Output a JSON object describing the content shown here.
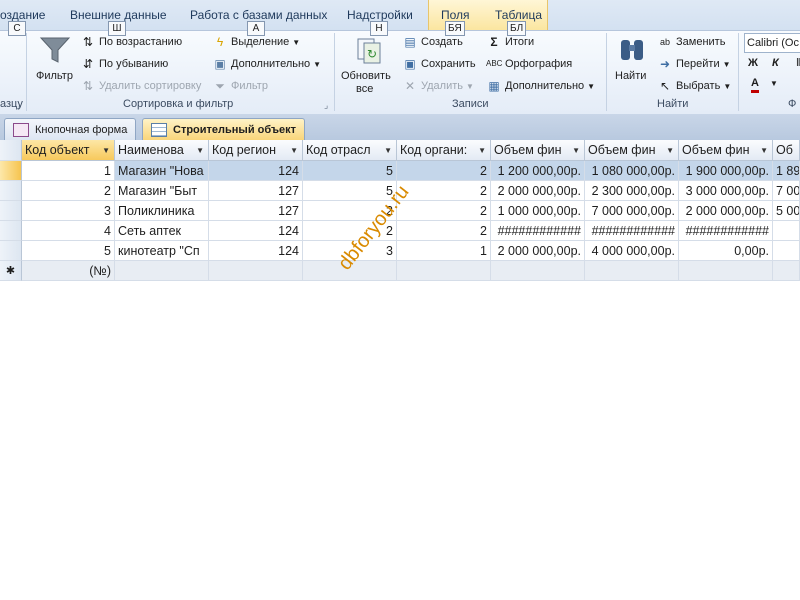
{
  "ribbon_tabs": [
    "оздание",
    "Внешние данные",
    "Работа с базами данных",
    "Надстройки",
    "Поля",
    "Таблица"
  ],
  "keytips": [
    "С",
    "Ш",
    "А",
    "Н",
    "БЯ",
    "БЛ"
  ],
  "sort_group": {
    "filter_label": "Фильтр",
    "ascending": "По возрастанию",
    "descending": "По убыванию",
    "remove_sort": "Удалить сортировку",
    "selection": "Выделение",
    "advanced": "Дополнительно",
    "toggle_filter": "Фильтр",
    "label": "Сортировка и фильтр"
  },
  "left_group": {
    "label": "азцу"
  },
  "records_group": {
    "refresh": "Обновить",
    "refresh_sub": "все",
    "new": "Создать",
    "save": "Сохранить",
    "delete": "Удалить",
    "totals": "Итоги",
    "spelling": "Орфография",
    "more": "Дополнительно",
    "label": "Записи"
  },
  "find_group": {
    "find": "Найти",
    "replace": "Заменить",
    "goto": "Перейти",
    "select": "Выбрать",
    "label": "Найти"
  },
  "font_group": {
    "font_name": "Calibri (Ос",
    "bold": "Ж",
    "italic": "К",
    "font_color": "А",
    "label": "Ф"
  },
  "doc_tabs": [
    {
      "label": "Кнопочная форма",
      "active": false
    },
    {
      "label": "Строительный объект",
      "active": true
    }
  ],
  "columns": [
    "Код объект",
    "Наименова",
    "Код регион",
    "Код отрасл",
    "Код органи:",
    "Объем фин",
    "Объем фин",
    "Объем фин",
    "Об"
  ],
  "rows": [
    [
      "1",
      "Магазин \"Нова",
      "124",
      "5",
      "2",
      "1 200 000,00р.",
      "1 080 000,00р.",
      "1 900 000,00р.",
      "1 89"
    ],
    [
      "2",
      "Магазин \"Быт",
      "127",
      "5",
      "2",
      "2 000 000,00р.",
      "2 300 000,00р.",
      "3 000 000,00р.",
      "7 00"
    ],
    [
      "3",
      "Поликлиника",
      "127",
      "2",
      "2",
      "1 000 000,00р.",
      "7 000 000,00р.",
      "2 000 000,00р.",
      "5 00"
    ],
    [
      "4",
      "Сеть аптек",
      "124",
      "2",
      "2",
      "############",
      "############",
      "############",
      ""
    ],
    [
      "5",
      "кинотеатр \"Сп",
      "124",
      "3",
      "1",
      "2 000 000,00р.",
      "4 000 000,00р.",
      "0,00р.",
      ""
    ]
  ],
  "new_row_marker": "✱",
  "new_row_placeholder": "(№)",
  "watermark": "dbforyou.ru",
  "colors": {
    "accent_selected_header": "#f7c95c",
    "selected_row": "#c4d6ea",
    "watermark": "#d98a00"
  }
}
